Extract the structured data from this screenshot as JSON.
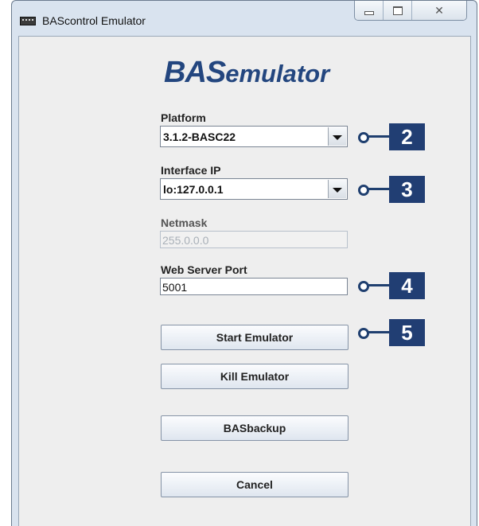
{
  "window": {
    "title": "BAScontrol Emulator",
    "controls": {
      "minimize": "minimize",
      "maximize": "maximize",
      "close": "close"
    }
  },
  "logo": {
    "part1": "BAS",
    "part2": "emulator",
    "color": "#23467f"
  },
  "form": {
    "platform": {
      "label": "Platform",
      "value": "3.1.2-BASC22"
    },
    "interface_ip": {
      "label": "Interface IP",
      "value": "lo:127.0.0.1"
    },
    "netmask": {
      "label": "Netmask",
      "value": "255.0.0.0",
      "disabled": true
    },
    "web_server_port": {
      "label": "Web Server Port",
      "value": "5001"
    }
  },
  "buttons": {
    "start": "Start Emulator",
    "kill": "Kill Emulator",
    "backup": "BASbackup",
    "cancel": "Cancel"
  },
  "callouts": [
    "2",
    "3",
    "4",
    "5"
  ],
  "colors": {
    "callout": "#213e73",
    "window_frame": "#d9e3ef"
  }
}
